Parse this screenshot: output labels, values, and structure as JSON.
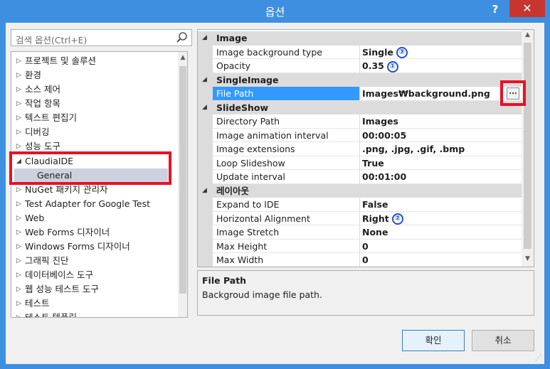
{
  "window": {
    "title": "옵션",
    "help": "?",
    "close": "✕"
  },
  "search": {
    "placeholder": "검색 옵션(Ctrl+E)"
  },
  "tree": {
    "items": [
      {
        "label": "프로젝트 및 솔루션"
      },
      {
        "label": "환경"
      },
      {
        "label": "소스 제어"
      },
      {
        "label": "작업 항목"
      },
      {
        "label": "텍스트 편집기"
      },
      {
        "label": "디버깅"
      },
      {
        "label": "성능 도구"
      },
      {
        "label": "ClaudiaIDE"
      },
      {
        "label": "General"
      },
      {
        "label": "NuGet 패키지 관리자"
      },
      {
        "label": "Test Adapter for Google Test"
      },
      {
        "label": "Web"
      },
      {
        "label": "Web Forms 디자이너"
      },
      {
        "label": "Windows Forms 디자이너"
      },
      {
        "label": "그래픽 진단"
      },
      {
        "label": "데이터베이스 도구"
      },
      {
        "label": "웹 성능 테스트 도구"
      },
      {
        "label": "테스트"
      },
      {
        "label": "테스트 템플릿"
      }
    ]
  },
  "grid": {
    "categories": {
      "image": "Image",
      "singleimage": "SingleImage",
      "slideshow": "SlideShow",
      "layout": "레이아웃"
    },
    "rows": {
      "bg_type": {
        "name": "Image background type",
        "value": "Single",
        "badge": "③"
      },
      "opacity": {
        "name": "Opacity",
        "value": "0.35",
        "badge": "①"
      },
      "file_path": {
        "name": "File Path",
        "value": "Images₩background.png",
        "button": "..."
      },
      "dir_path": {
        "name": "Directory Path",
        "value": "Images"
      },
      "anim_interval": {
        "name": "Image animation interval",
        "value": "00:00:05"
      },
      "extensions": {
        "name": "Image extensions",
        "value": ".png, .jpg, .gif, .bmp"
      },
      "loop": {
        "name": "Loop Slideshow",
        "value": "True"
      },
      "update_interval": {
        "name": "Update interval",
        "value": "00:01:00"
      },
      "expand": {
        "name": "Expand to IDE",
        "value": "False"
      },
      "h_align": {
        "name": "Horizontal Alignment",
        "value": "Right",
        "badge": "②"
      },
      "stretch": {
        "name": "Image Stretch",
        "value": "None"
      },
      "max_height": {
        "name": "Max Height",
        "value": "0"
      },
      "max_width": {
        "name": "Max Width",
        "value": "0"
      }
    }
  },
  "description": {
    "title": "File Path",
    "text": "Backgroud image file path."
  },
  "buttons": {
    "ok": "확인",
    "cancel": "취소"
  },
  "colors": {
    "title_bar": "#3e8fe0",
    "selection": "#3399ff",
    "highlight_box": "#e81123",
    "badge": "#1f4fd0"
  }
}
